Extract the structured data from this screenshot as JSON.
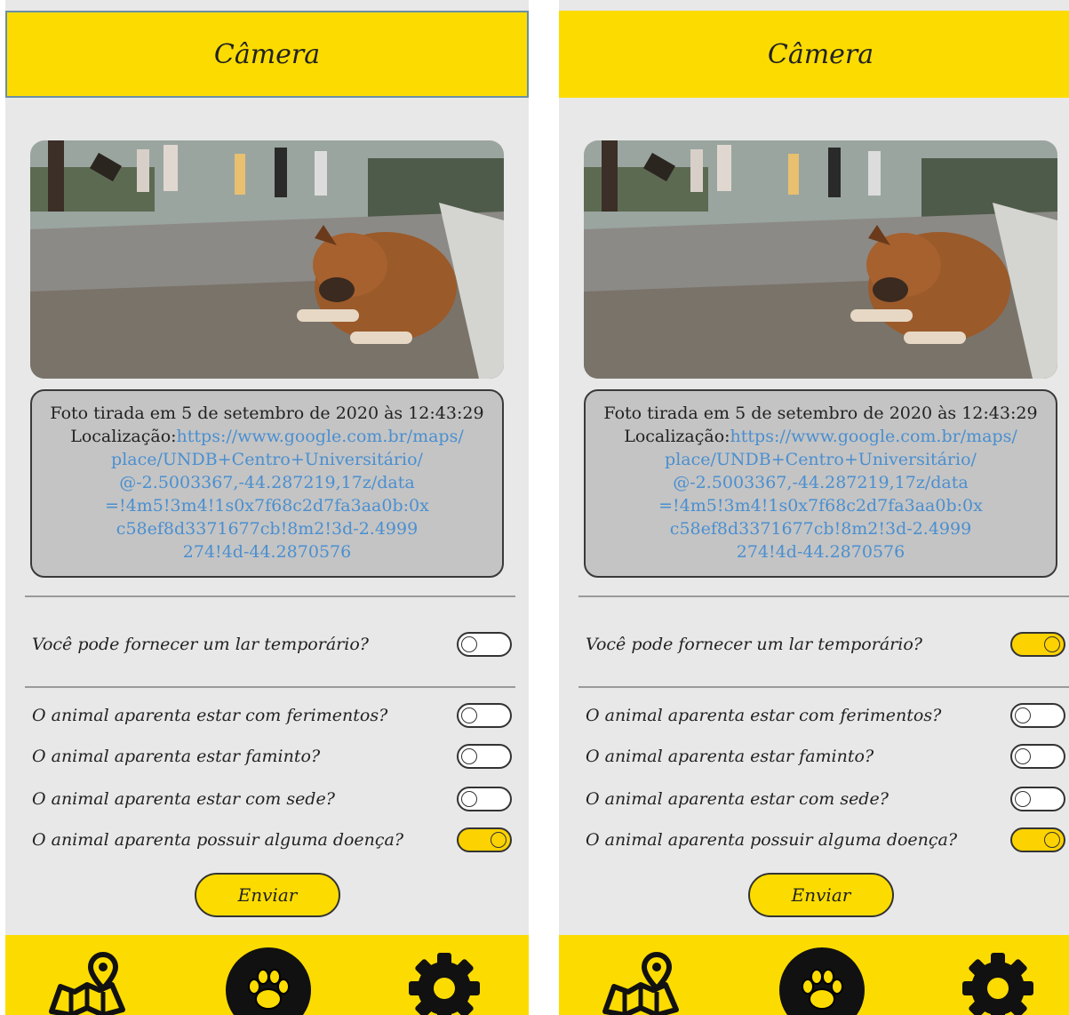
{
  "colors": {
    "accent_yellow": "#fcdc00",
    "background": "#e8e8e8",
    "info_box": "#c4c4c4",
    "link": "#4a8fd0"
  },
  "screens": [
    {
      "header": {
        "title": "Câmera"
      },
      "photo": {
        "alt": "dog-photo"
      },
      "info": {
        "caption": "Foto tirada em 5 de setembro de 2020 às 12:43:29",
        "location_label": "Localização:",
        "link_lines": [
          "https://www.google.com.br/maps/",
          "place/UNDB+Centro+Universitário/",
          "@-2.5003367,-44.287219,17z/data",
          "=!4m5!3m4!1s0x7f68c2d7fa3aa0b:0x",
          "c58ef8d3371677cb!8m2!3d-2.4999",
          "274!4d-44.2870576"
        ]
      },
      "temporary_home": {
        "label": "Você pode fornecer um lar temporário?",
        "on": false
      },
      "questions": [
        {
          "label": "O animal aparenta estar com ferimentos?",
          "on": false
        },
        {
          "label": "O animal aparenta estar faminto?",
          "on": false
        },
        {
          "label": "O animal aparenta estar com sede?",
          "on": false
        },
        {
          "label": "O animal aparenta possuir alguma doença?",
          "on": true
        }
      ],
      "send_button": "Enviar",
      "nav": {
        "items": [
          "map-icon",
          "paw-icon",
          "gear-icon"
        ],
        "active": "paw-icon"
      }
    },
    {
      "header": {
        "title": "Câmera"
      },
      "photo": {
        "alt": "dog-photo"
      },
      "info": {
        "caption": "Foto tirada em 5 de setembro de 2020 às 12:43:29",
        "location_label": "Localização:",
        "link_lines": [
          "https://www.google.com.br/maps/",
          "place/UNDB+Centro+Universitário/",
          "@-2.5003367,-44.287219,17z/data",
          "=!4m5!3m4!1s0x7f68c2d7fa3aa0b:0x",
          "c58ef8d3371677cb!8m2!3d-2.4999",
          "274!4d-44.2870576"
        ]
      },
      "temporary_home": {
        "label": "Você pode fornecer um lar temporário?",
        "on": true
      },
      "questions": [
        {
          "label": "O animal aparenta estar com ferimentos?",
          "on": false
        },
        {
          "label": "O animal aparenta estar faminto?",
          "on": false
        },
        {
          "label": "O animal aparenta estar com sede?",
          "on": false
        },
        {
          "label": "O animal aparenta possuir alguma doença?",
          "on": true
        }
      ],
      "send_button": "Enviar",
      "nav": {
        "items": [
          "map-icon",
          "paw-icon",
          "gear-icon"
        ],
        "active": "paw-icon"
      }
    }
  ]
}
